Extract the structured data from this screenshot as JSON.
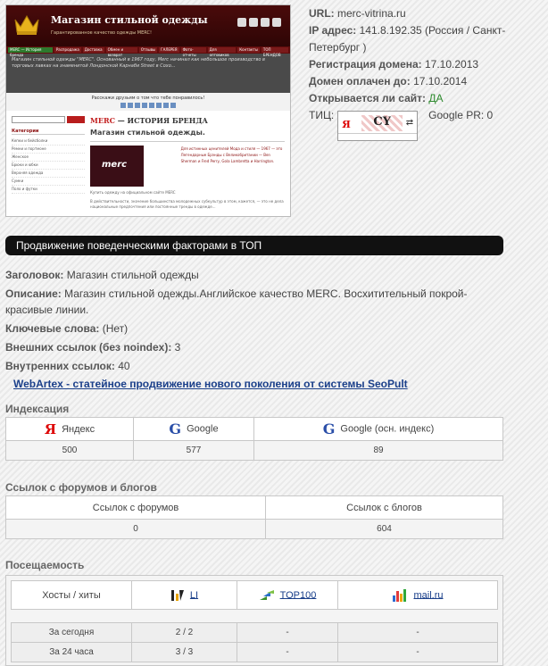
{
  "thumbnail": {
    "site_title": "Магазин стильной одежды",
    "site_subtitle": "Гарантированное качество одежды MERC!",
    "nav_items": [
      "MERC — История бренда",
      "Распродажа",
      "Доставка",
      "Обмен и возврат",
      "Отзывы",
      "ГАЛЕРЕЯ",
      "Фото-отчеты",
      "Для оптовиков",
      "Контакты",
      "ТОП БРЕНДОВ"
    ],
    "band_text": "Магазин стильной одежды \"MERC\". Основанный в 1967 году, Merc начинал как небольшое производство в торговых лавках на знаменитой Лондонской Карнаби Street в Сохо...",
    "share_text": "Расскажи друзьям о том что тебе понравилось!",
    "side_heading": "Категории",
    "side_items": [
      "Кепки и бейсболки",
      "Ремни и портмоне",
      "Женское",
      "Брюки и юбки",
      "Верхняя одежда",
      "Сумки",
      "Поло и футки"
    ],
    "article_brand": "MERC",
    "article_title": "— ИСТОРИЯ БРЕНДА",
    "article_subtitle": "Магазин стильной одежды.",
    "logo_text": "merc",
    "article_desc": "Для истинных ценителей Мода и стиля — 1967 — это Легендарные Брэнды с Великобритании — Ben Sherman и Fred Perry, Gola Lambretta и Harrington.",
    "logo_caption": "Купить одежду на официальном сайте MERC",
    "article_more": "В действительности, значение большинства молодежных субкультур в этом, кажется, — это не дела национальные предпочтения или постоянные тренды в одежде..."
  },
  "info": {
    "url_label": "URL:",
    "url_value": "merc-vitrina.ru",
    "ip_label": "IP адрес:",
    "ip_value": "141.8.192.35 (Россия / Санкт-Петербург )",
    "reg_label": "Регистрация домена:",
    "reg_value": "17.10.2013",
    "paid_label": "Домен оплачен до:",
    "paid_value": "17.10.2014",
    "open_label": "Открывается ли сайт:",
    "open_value": "ДА",
    "tic_label": "ТИЦ:",
    "tic_ya": "Я",
    "tic_cy": "CY",
    "pr_label": "Google PR: 0"
  },
  "banner": "Продвижение поведенческими факторами в ТОП",
  "meta": {
    "title_label": "Заголовок:",
    "title_value": "Магазин стильной одежды",
    "desc_label": "Описание:",
    "desc_value": "Магазин стильной одежды.Английское качество MERC. Восхитительный покрой-красивые линии.",
    "keys_label": "Ключевые слова:",
    "keys_value": "(Нет)",
    "ext_label": "Внешних ссылок (без noindex):",
    "ext_value": "3",
    "int_label": "Внутренних ссылок:",
    "int_value": "40"
  },
  "promo_link": "WebArtex - статейное продвижение нового поколения от системы SeoPult",
  "indexing": {
    "heading": "Индексация",
    "headers": [
      "Яндекс",
      "Google",
      "Google (осн. индекс)"
    ],
    "values": [
      "500",
      "577",
      "89"
    ]
  },
  "forums": {
    "heading": "Ссылок с форумов и блогов",
    "headers": [
      "Ссылок с форумов",
      "Ссылок с блогов"
    ],
    "values": [
      "0",
      "604"
    ]
  },
  "visits": {
    "heading": "Посещаемость",
    "col_label": "Хосты / хиты",
    "counters": [
      "LI",
      "TOP100",
      "mail.ru"
    ],
    "rows": [
      {
        "label": "За сегодня",
        "li": "2 / 2",
        "top": "-",
        "mail": "-"
      },
      {
        "label": "За 24 часа",
        "li": "3 / 3",
        "top": "-",
        "mail": "-"
      }
    ]
  }
}
